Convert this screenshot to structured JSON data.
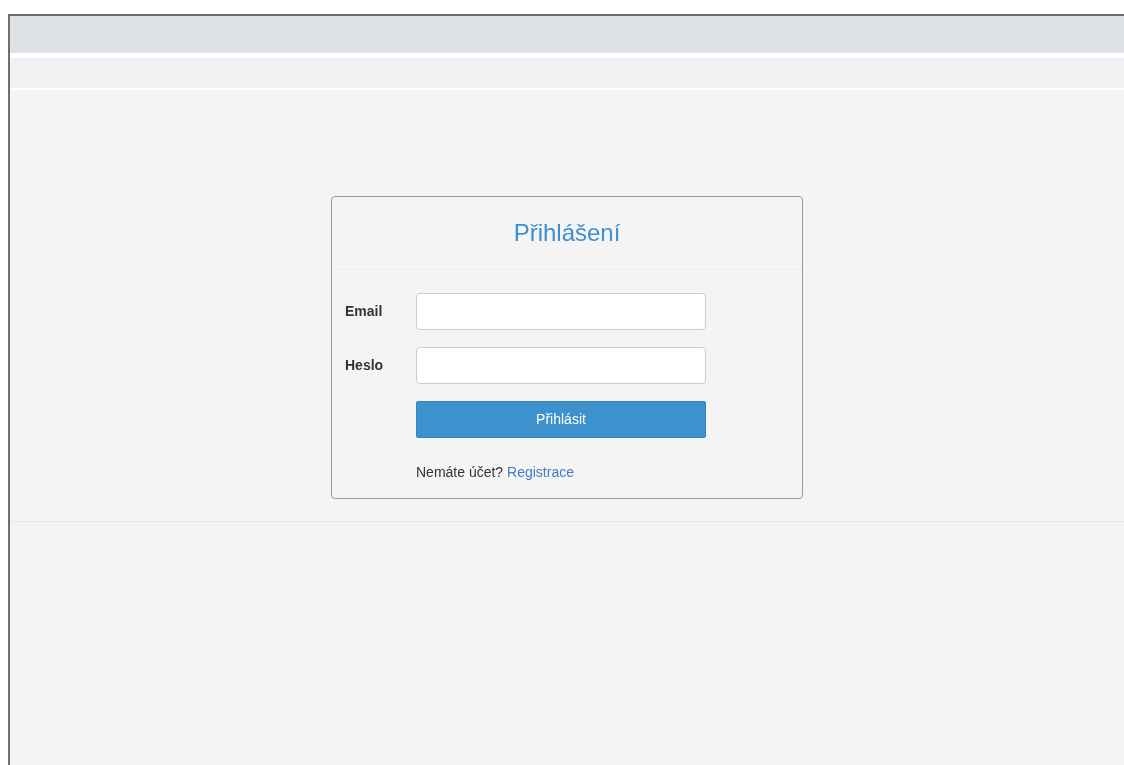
{
  "login": {
    "title": "Přihlášení",
    "fields": [
      {
        "label": "Email"
      },
      {
        "label": "Heslo"
      }
    ],
    "submit": "Přihlásit",
    "register_prompt": "Nemáte účet?",
    "register_link": "Registrace"
  }
}
